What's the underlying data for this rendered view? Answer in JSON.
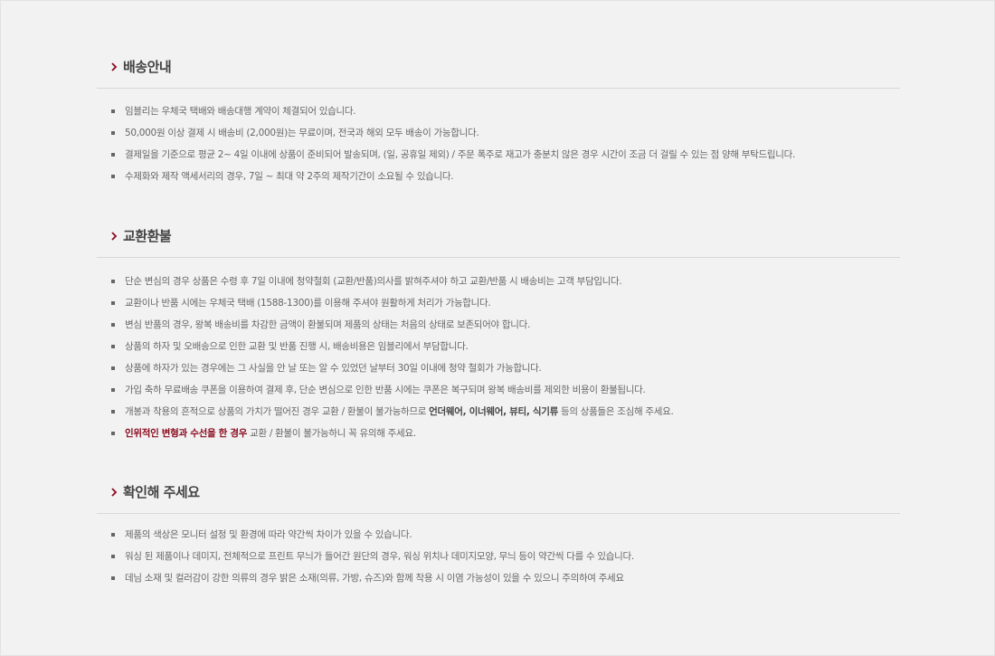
{
  "colors": {
    "chevron": "#8a0a1d",
    "warning_text": "#8a0a1d",
    "divider": "#d8d8d8",
    "background": "#f2f2f2"
  },
  "sections": [
    {
      "title": "배송안내",
      "icon": "chevron-right-icon",
      "items": [
        {
          "text": "임블리는 우체국 택배와 배송대행 계약이 체결되어 있습니다."
        },
        {
          "text": "50,000원 이상 결제 시 배송비 (2,000원)는 무료이며, 전국과 해외 모두 배송이 가능합니다."
        },
        {
          "text": "결제일을 기준으로 평균 2~ 4일 이내에 상품이 준비되어 발송되며, (일, 공휴일 제외) / 주문 폭주로 재고가 충분치 않은 경우 시간이 조금 더 걸릴 수 있는 점 양해 부탁드립니다."
        },
        {
          "text": "수제화와 제작 액세서리의 경우, 7일 ~ 최대 약 2주의 제작기간이 소요될 수 있습니다."
        }
      ]
    },
    {
      "title": "교환환불",
      "icon": "chevron-right-icon",
      "items": [
        {
          "text": "단순 변심의 경우 상품은 수령 후 7일 이내에 청약철회 (교환/반품)의사를 밝혀주셔야 하고 교환/반품 시 배송비는 고객 부담입니다."
        },
        {
          "text": "교환이나 반품 시에는 우체국 택배 (1588-1300)를 이용해 주셔야 원활하게 처리가 가능합니다."
        },
        {
          "text": "변심 반품의 경우, 왕복 배송비를 차감한 금액이 환불되며 제품의 상태는 처음의 상태로 보존되어야 합니다."
        },
        {
          "text": "상품의 하자 및 오배송으로 인한 교환 및 반품 진행 시, 배송비용은 임블리에서 부담합니다."
        },
        {
          "text": "상품에 하자가 있는 경우에는 그 사실을 안 날 또는 알 수 있었던 날부터 30일 이내에 청약 철회가 가능합니다."
        },
        {
          "text": "가입 축하 무료배송 쿠폰을 이용하여 결제 후, 단순 변심으로 인한 반품 시에는 쿠폰은 복구되며 왕복 배송비를 제외한 비용이 환불됩니다."
        },
        {
          "pre": "개봉과 착용의 흔적으로 상품의 가치가 떨어진 경우 교환 / 환불이 불가능하므로 ",
          "bold": "언더웨어, 이너웨어, 뷰티, 식기류",
          "post": " 등의 상품들은 조심해 주세요."
        },
        {
          "warn": "인위적인 변형과 수선을 한 경우",
          "post": " 교환 / 환불이 불가능하니 꼭 유의해 주세요."
        }
      ]
    },
    {
      "title": "확인해 주세요",
      "icon": "chevron-right-icon",
      "items": [
        {
          "text": "제품의 색상은 모니터 설정 및 환경에 따라 약간씩 차이가 있을 수 있습니다."
        },
        {
          "text": "워싱 된 제품이나 데미지, 전체적으로 프린트 무늬가 들어간 원단의 경우, 워싱 위치나 데미지모양, 무늬 등이 약간씩 다를 수 있습니다."
        },
        {
          "text": "데님 소재 및 컬러감이 강한 의류의 경우 밝은 소재(의류, 가방, 슈즈)와 함께 착용 시 이염 가능성이 있을 수 있으니 주의하여 주세요"
        }
      ]
    }
  ]
}
